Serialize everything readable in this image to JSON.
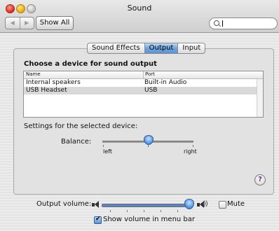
{
  "window": {
    "title": "Sound"
  },
  "toolbar": {
    "back_glyph": "◀",
    "forward_glyph": "▶",
    "show_all_label": "Show All",
    "search_value": ""
  },
  "tabs": [
    {
      "label": "Sound Effects",
      "selected": false
    },
    {
      "label": "Output",
      "selected": true
    },
    {
      "label": "Input",
      "selected": false
    }
  ],
  "output": {
    "choose_heading": "Choose a device for sound output",
    "columns": [
      "Name",
      "Port"
    ],
    "devices": [
      {
        "name": "Internal speakers",
        "port": "Built-in Audio",
        "selected": false
      },
      {
        "name": "USB Headset",
        "port": "USB",
        "selected": true
      }
    ],
    "settings_label": "Settings for the selected device:",
    "balance_label": "Balance:",
    "balance_left": "left",
    "balance_right": "right",
    "balance_value": 0.5
  },
  "help_glyph": "?",
  "volume": {
    "label": "Output volume:",
    "value": 0.95,
    "mute_label": "Mute",
    "mute_checked": false,
    "menu_bar_label": "Show volume in menu bar",
    "menu_bar_checked": true
  },
  "icons": {
    "search": "magnifier-icon",
    "speaker_low": "speaker-low-icon",
    "speaker_high": "speaker-high-icon",
    "help": "help-icon"
  },
  "colors": {
    "accent": "#5c94d4",
    "selection_row": "#d9d9d9"
  }
}
